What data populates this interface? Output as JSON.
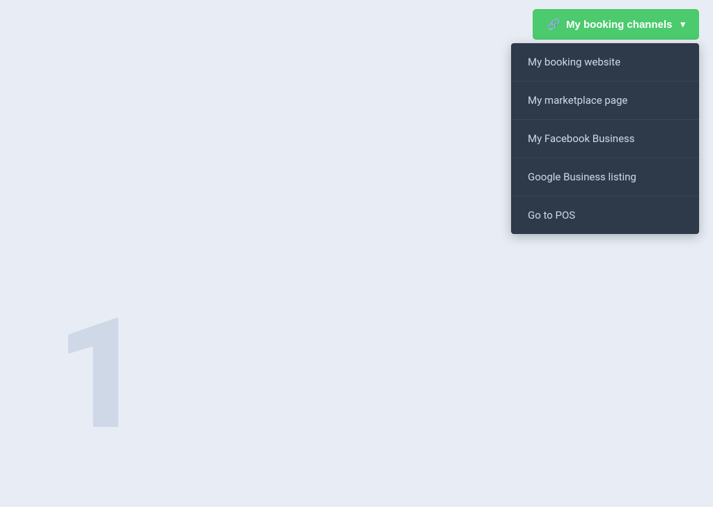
{
  "page": {
    "background_color": "#e8edf5",
    "watermark": "1"
  },
  "header": {
    "booking_channels_button": {
      "label": "My booking channels",
      "icon": "🔗",
      "chevron": "▾",
      "color": "#4cca6e"
    }
  },
  "dropdown": {
    "items": [
      {
        "id": "booking-website",
        "label": "My booking website"
      },
      {
        "id": "marketplace-page",
        "label": "My marketplace page"
      },
      {
        "id": "facebook-business",
        "label": "My Facebook Business"
      },
      {
        "id": "google-business",
        "label": "Google Business listing"
      },
      {
        "id": "go-to-pos",
        "label": "Go to POS"
      }
    ]
  }
}
